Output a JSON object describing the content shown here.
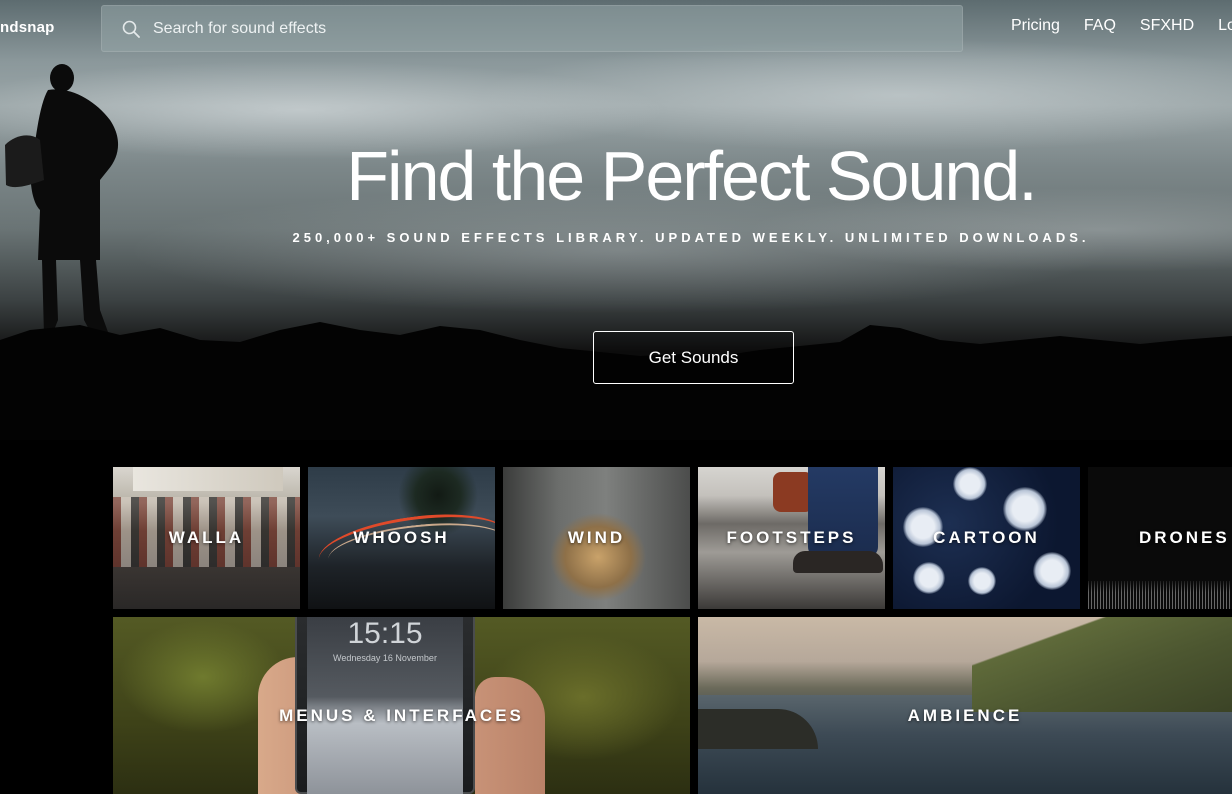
{
  "brand": {
    "logo_text": "ndsnap"
  },
  "search": {
    "placeholder": "Search for sound effects",
    "value": ""
  },
  "nav": {
    "items": [
      "Pricing",
      "FAQ",
      "SFXHD",
      "Lo"
    ]
  },
  "hero": {
    "headline": "Find the Perfect Sound.",
    "subline": "250,000+ SOUND EFFECTS LIBRARY. UPDATED WEEKLY. UNLIMITED DOWNLOADS.",
    "cta_label": "Get Sounds"
  },
  "categories": {
    "row1": [
      "WALLA",
      "WHOOSH",
      "WIND",
      "FOOTSTEPS",
      "CARTOON",
      "DRONES"
    ],
    "row2": [
      "MENUS & INTERFACES",
      "AMBIENCE"
    ]
  },
  "phone_screen": {
    "time": "15:15",
    "date": "Wednesday 16 November"
  },
  "colors": {
    "background": "#000000",
    "text": "#ffffff",
    "button_border": "#ffffff"
  }
}
